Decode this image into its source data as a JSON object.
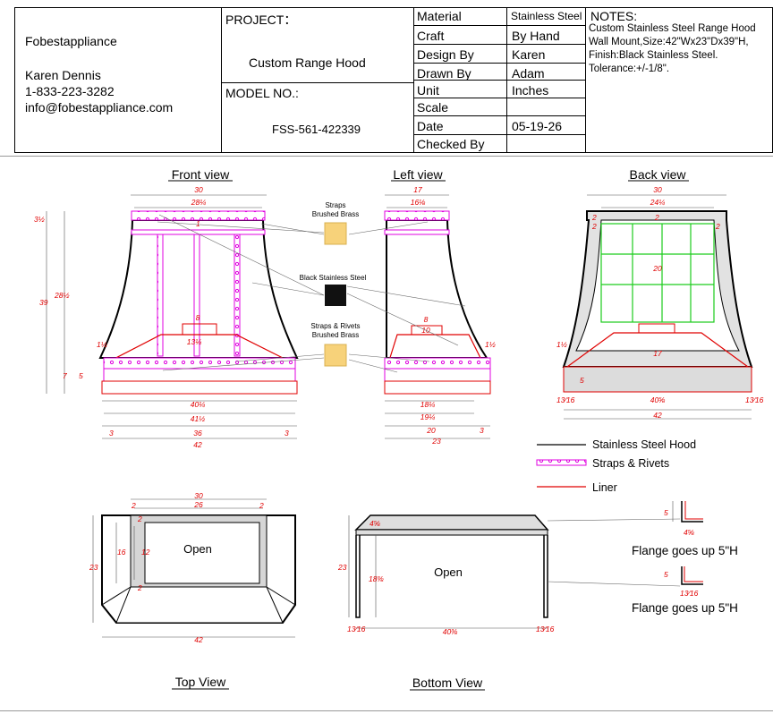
{
  "title_block": {
    "company": "Fobestappliance",
    "contact_name": "Karen Dennis",
    "phone": "1-833-223-3282",
    "email": "info@fobestappliance.com",
    "project_label": "PROJECT：",
    "project_value": "Custom Range Hood",
    "model_label": "MODEL NO.:",
    "model_value": "FSS-561-422339",
    "specs": [
      {
        "label": "Material",
        "value": "Stainless Steel"
      },
      {
        "label": "Craft",
        "value": "By Hand"
      },
      {
        "label": "Design By",
        "value": "Karen"
      },
      {
        "label": "Drawn By",
        "value": "Adam"
      },
      {
        "label": "Unit",
        "value": "Inches"
      },
      {
        "label": "Scale",
        "value": ""
      },
      {
        "label": "Date",
        "value": "05-19-26"
      },
      {
        "label": "Checked By",
        "value": ""
      }
    ],
    "notes_title": "NOTES:",
    "notes_text": "Custom Stainless Steel Range Hood Wall Mount,Size:42\"Wx23\"Dx39\"H, Finish:Black Stainless Steel. Tolerance:+/-1/8\"."
  },
  "views": {
    "front": "Front view",
    "left": "Left view",
    "back": "Back view",
    "top": "Top View",
    "bottom": "Bottom View"
  },
  "callouts": {
    "straps_1": "Straps",
    "straps_2": "Brushed Brass",
    "finish": "Black Stainless Steel",
    "rivets_1": "Straps & Rivets",
    "rivets_2": "Brushed Brass",
    "open_top": "Open",
    "open_bottom": "Open",
    "flange_1": "Flange goes up 5\"H",
    "flange_2": "Flange goes up 5\"H"
  },
  "swatches": {
    "brass": "#f7d27a",
    "black": "#111111"
  },
  "legend": [
    {
      "label": "Stainless Steel Hood",
      "color": "#000000",
      "style": "solid"
    },
    {
      "label": "Straps & Rivets",
      "color": "#e000e0",
      "style": "strap"
    },
    {
      "label": "Liner",
      "color": "#e00000",
      "style": "solid"
    }
  ],
  "dims": {
    "front": {
      "top_outer": "30",
      "top_inner": "28¼",
      "left_top": "3½",
      "body_h": "28½",
      "total_h": "39",
      "side_bump": "1½",
      "small_w": "8",
      "liner_w": "13¼",
      "flange_h": "7",
      "flange_h2": "5",
      "liner_mark": "1",
      "b1": "40¼",
      "b2": "41½",
      "b_left": "3",
      "b_mid": "36",
      "b_right": "3",
      "b_total": "42"
    },
    "left": {
      "top_outer": "17",
      "top_inner": "16⅛",
      "small_w": "8",
      "small_w2": "10",
      "side_bump": "1½",
      "b1": "18¼",
      "b2": "19¼",
      "b_mid": "20",
      "b_right": "3",
      "b_total": "23"
    },
    "back": {
      "top_outer": "30",
      "top_inner": "24¼",
      "corner1": "2",
      "corner2": "2",
      "corner3": "2",
      "corner4": "2",
      "grid_h": "20",
      "liner_h": "17",
      "side_bump": "1½",
      "flange_h": "5",
      "left_corner": "13⁄16",
      "b_mid": "40⅝",
      "right_corner": "13⁄16",
      "b_total": "42"
    },
    "top": {
      "w_outer": "30",
      "w_inner": "26",
      "c1": "2",
      "c2": "2",
      "c3": "2",
      "c4": "2",
      "depth_outer": "16",
      "depth_inner": "12",
      "depth_total": "23",
      "w_total": "42"
    },
    "bottom": {
      "lip": "4⅝",
      "depth_inner": "18⅜",
      "depth_total": "23",
      "left_corner": "13⁄16",
      "b_mid": "40⅜",
      "right_corner": "13⁄16"
    },
    "flange": {
      "h1": "5",
      "w1": "4⅝",
      "h2": "5",
      "w2": "13⁄16"
    }
  }
}
